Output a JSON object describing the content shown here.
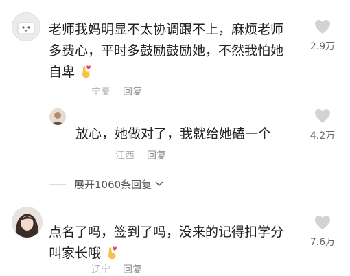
{
  "comments": [
    {
      "text_line1": "老师我妈明显不太协调跟不上，麻烦老师",
      "text_line2": "多费心，平时多鼓励鼓励她，不然我怕她",
      "text_line3": "自卑",
      "location": "宁夏",
      "reply_label": "回复",
      "like_count": "2.9万"
    },
    {
      "text_line1": "放心，她做对了，我就给她磕一个",
      "location": "江西",
      "reply_label": "回复",
      "like_count": "4.2万"
    },
    {
      "text_line1": "点名了吗，签到了吗，没来的记得扣学分",
      "text_line2": "叫家长哦",
      "location": "辽宁",
      "reply_label": "回复",
      "like_count": "7.6万"
    }
  ],
  "expand_replies": "展开1060条回复",
  "icons": {
    "like": "heart-outline-icon",
    "expand": "chevron-down-icon",
    "emoji": "finger-heart-emoji"
  },
  "colors": {
    "text": "#222222",
    "meta": "#a7a7a7",
    "heart": "#c8c8c8",
    "emoji_skin": "#f6c343",
    "emoji_heart": "#e8416b"
  }
}
